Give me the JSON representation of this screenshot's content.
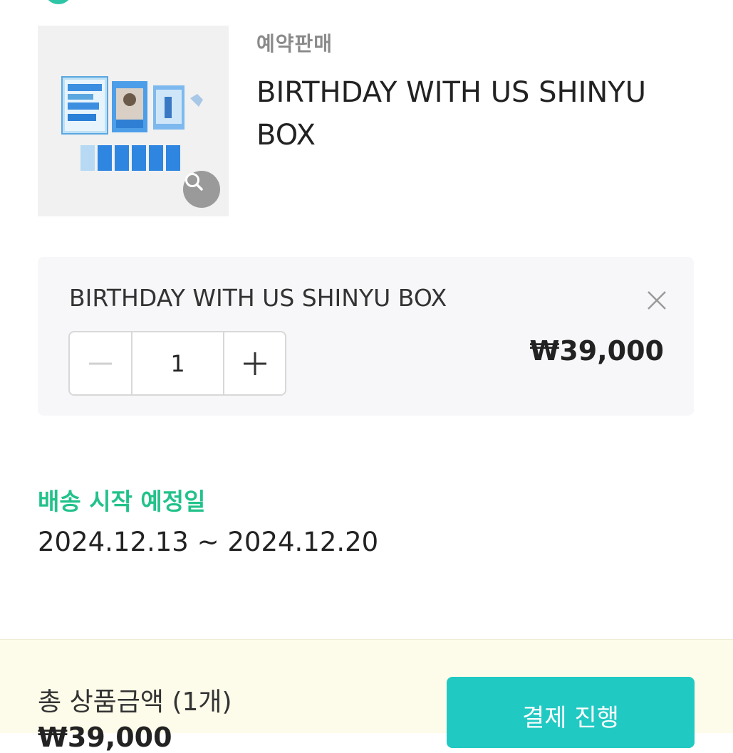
{
  "product": {
    "sale_type": "예약판매",
    "title": "BIRTHDAY WITH US SHINYU BOX"
  },
  "option": {
    "name": "BIRTHDAY WITH US SHINYU BOX",
    "quantity": "1",
    "price": "₩39,000"
  },
  "shipping": {
    "label": "배송 시작 예정일",
    "date_range": "2024.12.13 ~ 2024.12.20"
  },
  "footer": {
    "total_label": "총 상품금액 (1개)",
    "total_price": "₩39,000",
    "checkout_label": "결제 진행"
  },
  "icons": {
    "zoom": "magnifier-icon",
    "remove": "close-icon",
    "minus": "minus-icon",
    "plus": "plus-icon"
  },
  "colors": {
    "accent_green": "#22c28a",
    "checkout_teal": "#21c9c3",
    "footer_bg": "#fdfbe9"
  }
}
